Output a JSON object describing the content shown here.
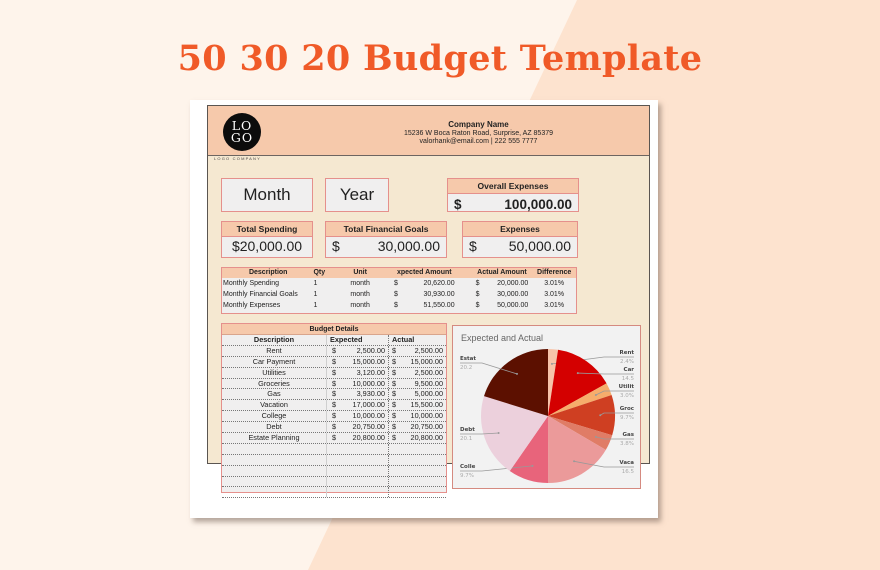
{
  "page_title": "50 30 20 Budget Template",
  "header": {
    "logo_text_line1": "LO",
    "logo_text_line2": "GO",
    "logo_caption": "LOGO COMPANY",
    "company_name": "Company Name",
    "address": "15236 W Boca Raton Road, Surprise,  AZ 85379",
    "contact": "valorhank@email.com  |  222 555 7777"
  },
  "period": {
    "month_label": "Month",
    "year_label": "Year"
  },
  "overall_expenses": {
    "label": "Overall Expenses",
    "currency": "$",
    "amount": "100,000.00"
  },
  "totals": [
    {
      "label": "Total Spending",
      "currency": "",
      "amount": "$20,000.00"
    },
    {
      "label": "Total Financial Goals",
      "currency": "$",
      "amount": "30,000.00"
    },
    {
      "label": "Expenses",
      "currency": "$",
      "amount": "50,000.00"
    }
  ],
  "summary_table": {
    "headers": [
      "Description",
      "Qty",
      "Unit",
      "xpected Amount",
      "Actual Amount",
      "Difference"
    ],
    "rows": [
      {
        "description": "Monthly Spending",
        "qty": "1",
        "unit": "month",
        "expected_cur": "$",
        "expected": "20,620.00",
        "actual_cur": "$",
        "actual": "20,000.00",
        "difference": "3.01%"
      },
      {
        "description": "Monthly Financial Goals",
        "qty": "1",
        "unit": "month",
        "expected_cur": "$",
        "expected": "30,930.00",
        "actual_cur": "$",
        "actual": "30,000.00",
        "difference": "3.01%"
      },
      {
        "description": "Monthly Expenses",
        "qty": "1",
        "unit": "month",
        "expected_cur": "$",
        "expected": "51,550.00",
        "actual_cur": "$",
        "actual": "50,000.00",
        "difference": "3.01%"
      }
    ]
  },
  "budget_details": {
    "title": "Budget Details",
    "headers": [
      "Description",
      "Expected",
      "Actual"
    ],
    "rows": [
      {
        "description": "Rent",
        "expected": "2,500.00",
        "actual": "2,500.00"
      },
      {
        "description": "Car Payment",
        "expected": "15,000.00",
        "actual": "15,000.00"
      },
      {
        "description": "Utilities",
        "expected": "3,120.00",
        "actual": "2,500.00"
      },
      {
        "description": "Groceries",
        "expected": "10,000.00",
        "actual": "9,500.00"
      },
      {
        "description": "Gas",
        "expected": "3,930.00",
        "actual": "5,000.00"
      },
      {
        "description": "Vacation",
        "expected": "17,000.00",
        "actual": "15,500.00"
      },
      {
        "description": "College",
        "expected": "10,000.00",
        "actual": "10,000.00"
      },
      {
        "description": "Debt",
        "expected": "20,750.00",
        "actual": "20,750.00"
      },
      {
        "description": "Estate Planning",
        "expected": "20,800.00",
        "actual": "20,800.00"
      },
      {
        "description": "",
        "expected": "",
        "actual": ""
      },
      {
        "description": "",
        "expected": "",
        "actual": ""
      },
      {
        "description": "",
        "expected": "",
        "actual": ""
      },
      {
        "description": "",
        "expected": "",
        "actual": ""
      },
      {
        "description": "",
        "expected": "",
        "actual": ""
      }
    ],
    "currency": "$"
  },
  "chart_data": {
    "type": "pie",
    "title": "Expected and Actual",
    "categories": [
      "Rent",
      "Car",
      "Utilit",
      "Groc",
      "Gas",
      "Vaca",
      "Colle",
      "Debt",
      "Estat"
    ],
    "values": [
      2.4,
      14.5,
      3.0,
      9.7,
      3.8,
      16.5,
      9.7,
      20.1,
      20.2
    ],
    "value_labels": [
      "2.4%",
      "14.5",
      "3.0%",
      "9.7%",
      "3.8%",
      "16.5",
      "9.7%",
      "20.1",
      "20.2"
    ],
    "colors": [
      "#f7c3a9",
      "#d40000",
      "#f6ad6c",
      "#cf3f22",
      "#e07c66",
      "#eb9a9a",
      "#e8647b",
      "#ecd0dc",
      "#5c1000"
    ],
    "start": "top",
    "direction": "clockwise"
  }
}
